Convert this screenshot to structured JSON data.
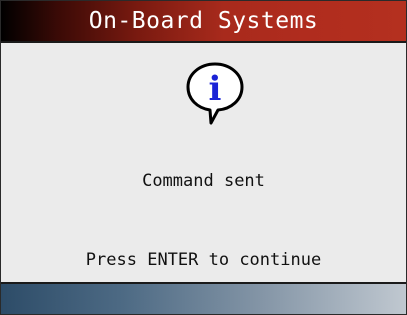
{
  "screen": {
    "title": "On-Board Systems",
    "icon": "info-speech-bubble-icon",
    "message": "Command sent",
    "prompt": "Press ENTER to continue"
  },
  "colors": {
    "title_bar_start": "#000000",
    "title_bar_end": "#b4301f",
    "title_text": "#ffffff",
    "background": "#ebebeb",
    "info_glyph": "#1a23d6",
    "bottom_bar_start": "#2d4c68",
    "bottom_bar_end": "#c0c8d0"
  }
}
